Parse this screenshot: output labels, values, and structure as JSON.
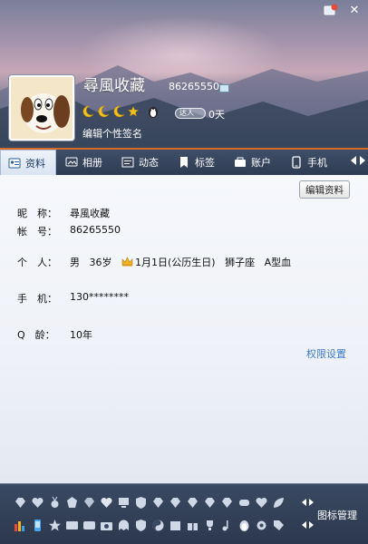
{
  "header": {
    "nickname": "尋風收藏",
    "qq_number": "86265550",
    "level_icons": [
      "moon-icon",
      "moon-icon",
      "moon-icon",
      "star-icon"
    ],
    "vip_label": "达人",
    "vip_days": "0天",
    "signature_placeholder": "编辑个性签名"
  },
  "window_controls": {
    "skin": "skin-icon",
    "close": "✕"
  },
  "tabs": [
    {
      "label": "资料",
      "icon": "profile-card-icon",
      "active": true
    },
    {
      "label": "相册",
      "icon": "photo-album-icon",
      "active": false
    },
    {
      "label": "动态",
      "icon": "feed-icon",
      "active": false
    },
    {
      "label": "标签",
      "icon": "bookmark-icon",
      "active": false
    },
    {
      "label": "账户",
      "icon": "wallet-icon",
      "active": false
    },
    {
      "label": "手机",
      "icon": "phone-icon",
      "active": false
    }
  ],
  "profile": {
    "edit_button": "编辑资料",
    "nickname_label": "昵　称：",
    "nickname_value": "尋風收藏",
    "account_label": "帐　号：",
    "account_value": "86265550",
    "personal_label": "个　人：",
    "gender": "男",
    "age": "36岁",
    "birthday": "1月1日(公历生日)",
    "zodiac": "狮子座",
    "blood_type": "A型血",
    "phone_label": "手　机：",
    "phone_value": "130********",
    "q_age_label": "Q　龄：",
    "q_age_value": "10年",
    "permission_link": "权限设置"
  },
  "footer": {
    "icon_management": "图标管理"
  },
  "colors": {
    "tab_bar_bg": "#2e3b52",
    "accent_orange": "#d66a2a",
    "link_blue": "#3c7dc9"
  }
}
